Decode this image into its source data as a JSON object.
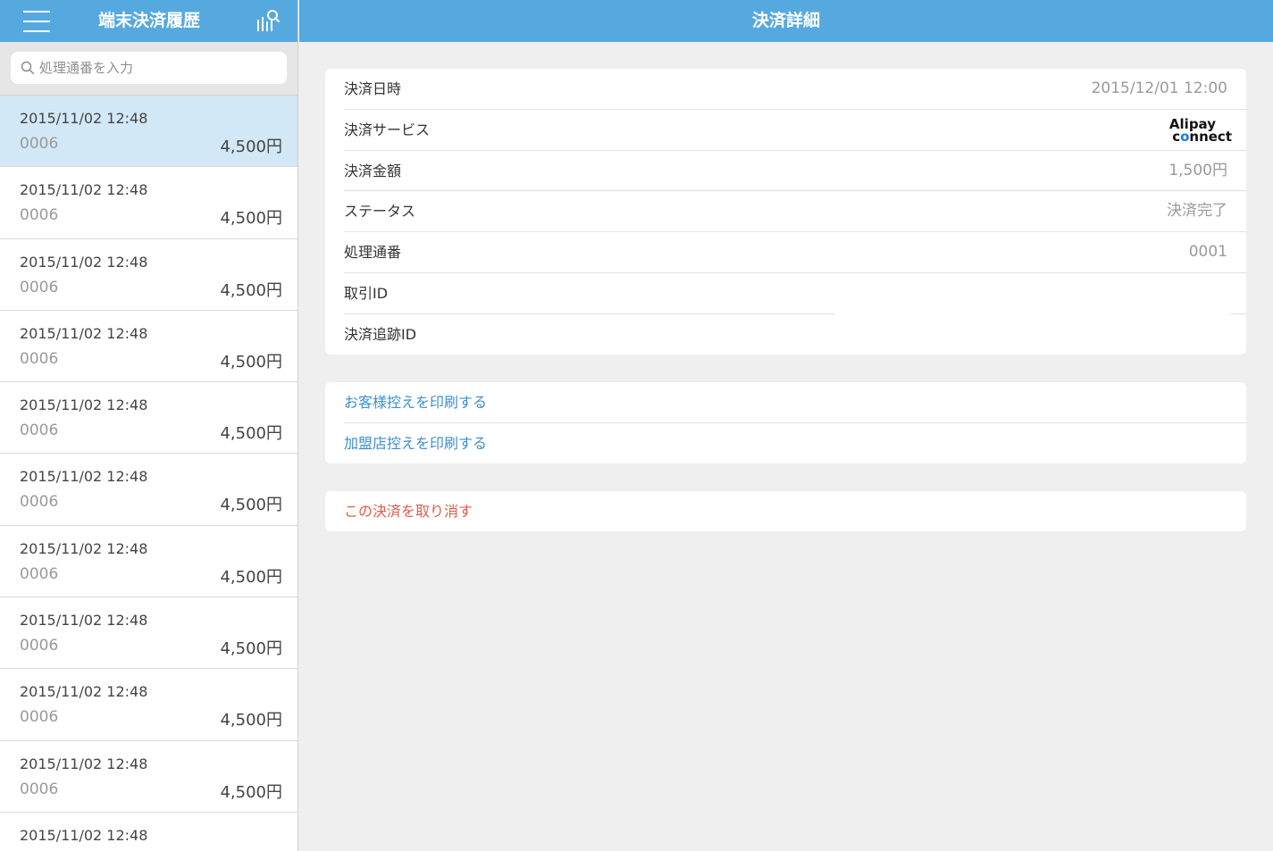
{
  "left_header": {
    "title": "端末決済履歴",
    "menu_icon": "hamburger-menu-icon",
    "filter_icon": "search-filter-icon"
  },
  "search": {
    "placeholder": "処理通番を入力",
    "value": ""
  },
  "history": [
    {
      "date": "2015/11/02 12:48",
      "code": "0006",
      "amount": "4,500円",
      "selected": true
    },
    {
      "date": "2015/11/02 12:48",
      "code": "0006",
      "amount": "4,500円"
    },
    {
      "date": "2015/11/02 12:48",
      "code": "0006",
      "amount": "4,500円"
    },
    {
      "date": "2015/11/02 12:48",
      "code": "0006",
      "amount": "4,500円"
    },
    {
      "date": "2015/11/02 12:48",
      "code": "0006",
      "amount": "4,500円"
    },
    {
      "date": "2015/11/02 12:48",
      "code": "0006",
      "amount": "4,500円"
    },
    {
      "date": "2015/11/02 12:48",
      "code": "0006",
      "amount": "4,500円"
    },
    {
      "date": "2015/11/02 12:48",
      "code": "0006",
      "amount": "4,500円"
    },
    {
      "date": "2015/11/02 12:48",
      "code": "0006",
      "amount": "4,500円"
    },
    {
      "date": "2015/11/02 12:48",
      "code": "0006",
      "amount": "4,500円"
    },
    {
      "date": "2015/11/02 12:48",
      "code": "",
      "amount": ""
    }
  ],
  "right_header": {
    "title": "決済詳細"
  },
  "details": {
    "datetime_label": "決済日時",
    "datetime_value": "2015/12/01 12:00",
    "service_label": "決済サービス",
    "service_logo_line1": "Alipay",
    "service_logo_line2": "connect",
    "amount_label": "決済金額",
    "amount_value": "1,500円",
    "status_label": "ステータス",
    "status_value": "決済完了",
    "seq_label": "処理通番",
    "seq_value": "0001",
    "transaction_label": "取引ID",
    "transaction_value": "",
    "tracking_label": "決済追跡ID",
    "tracking_value": ""
  },
  "actions": {
    "print_customer": "お客様控えを印刷する",
    "print_merchant": "加盟店控えを印刷する",
    "cancel": "この決済を取り消す"
  },
  "colors": {
    "header": "#55a9df",
    "selected_row": "#d2e8f6",
    "link": "#3d8fce",
    "danger": "#e25c4b",
    "background": "#efefef"
  }
}
